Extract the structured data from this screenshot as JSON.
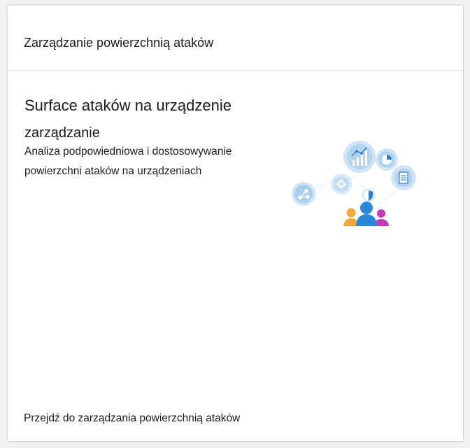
{
  "card": {
    "title": "Zarządzanie powierzchnią ataków",
    "heading_line1": "Surface ataków na urządzenie",
    "heading_line2": "zarządzanie",
    "description": "Analiza podpowiedniowa i dostosowywanie powierzchni ataków na urządzeniach",
    "footer_link": "Przejdź do zarządzania powierzchnią ataków"
  },
  "illustration": {
    "icons": [
      "share-node-icon",
      "gear-icon",
      "line-chart-icon",
      "pie-chart-icon",
      "document-icon",
      "shield-icon",
      "people-group-icon"
    ]
  },
  "colors": {
    "circle_fill": "#cfe4f6",
    "icon_accent": "#2b7cd3",
    "person_left": "#f2a93b",
    "person_center": "#2b88d8",
    "person_right": "#c239b3"
  }
}
